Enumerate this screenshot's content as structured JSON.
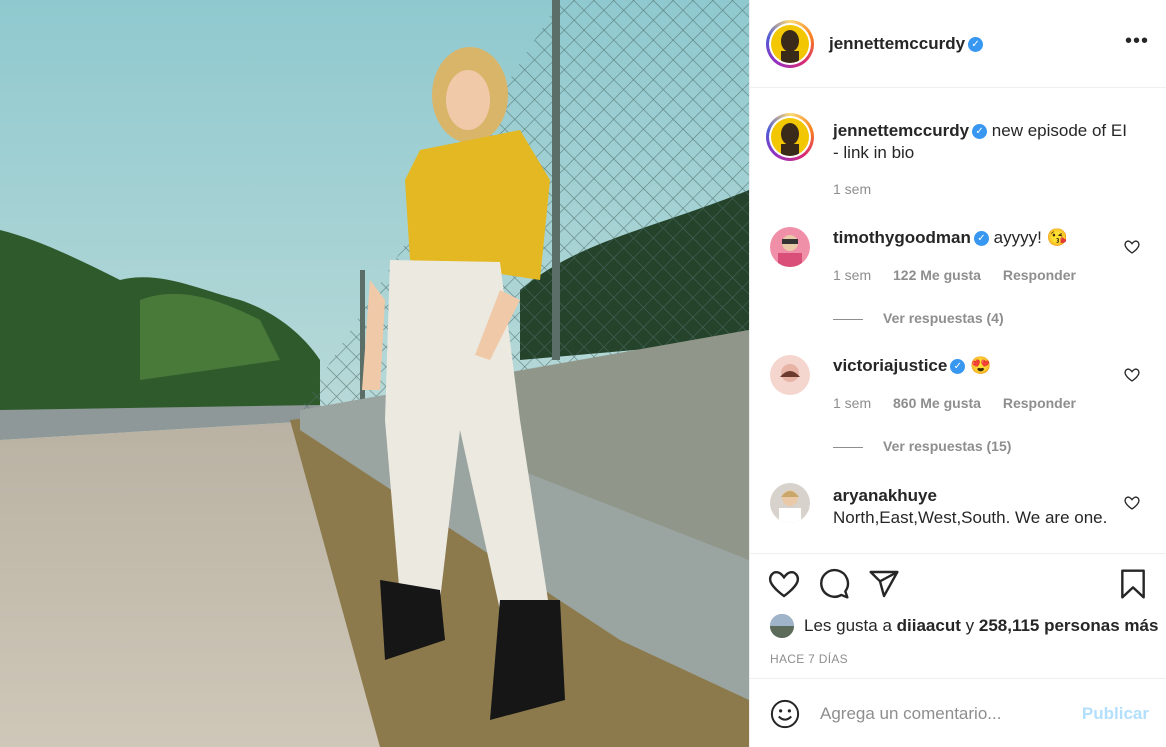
{
  "author": {
    "username": "jennettemccurdy",
    "caption": "new episode of EI - link in bio",
    "caption_age": "1 sem"
  },
  "comments": [
    {
      "username": "timothygoodman",
      "text": "ayyyy! 😘",
      "age": "1 sem",
      "likes": "122 Me gusta",
      "reply_label": "Responder",
      "view_replies": "Ver respuestas (4)"
    },
    {
      "username": "victoriajustice",
      "text": "😍",
      "age": "1 sem",
      "likes": "860 Me gusta",
      "reply_label": "Responder",
      "view_replies": "Ver respuestas (15)"
    },
    {
      "username": "aryanakhuye",
      "text": "North,East,West,South. We are one."
    }
  ],
  "likes_summary": {
    "prefix": "Les gusta a",
    "user": "diiaacut",
    "connector": "y",
    "count_text": "258,115 personas más"
  },
  "date_label": "HACE 7 DÍAS",
  "composer": {
    "placeholder": "Agrega un comentario...",
    "publish_label": "Publicar"
  },
  "icons": {
    "more": "more-options-icon",
    "like": "heart-icon",
    "comment": "comment-icon",
    "share": "paper-plane-icon",
    "save": "bookmark-icon",
    "emoji": "smiley-icon"
  },
  "colors": {
    "verified": "#3897f0",
    "publish_disabled": "#b2dffc",
    "muted_text": "#8e8e8e"
  }
}
